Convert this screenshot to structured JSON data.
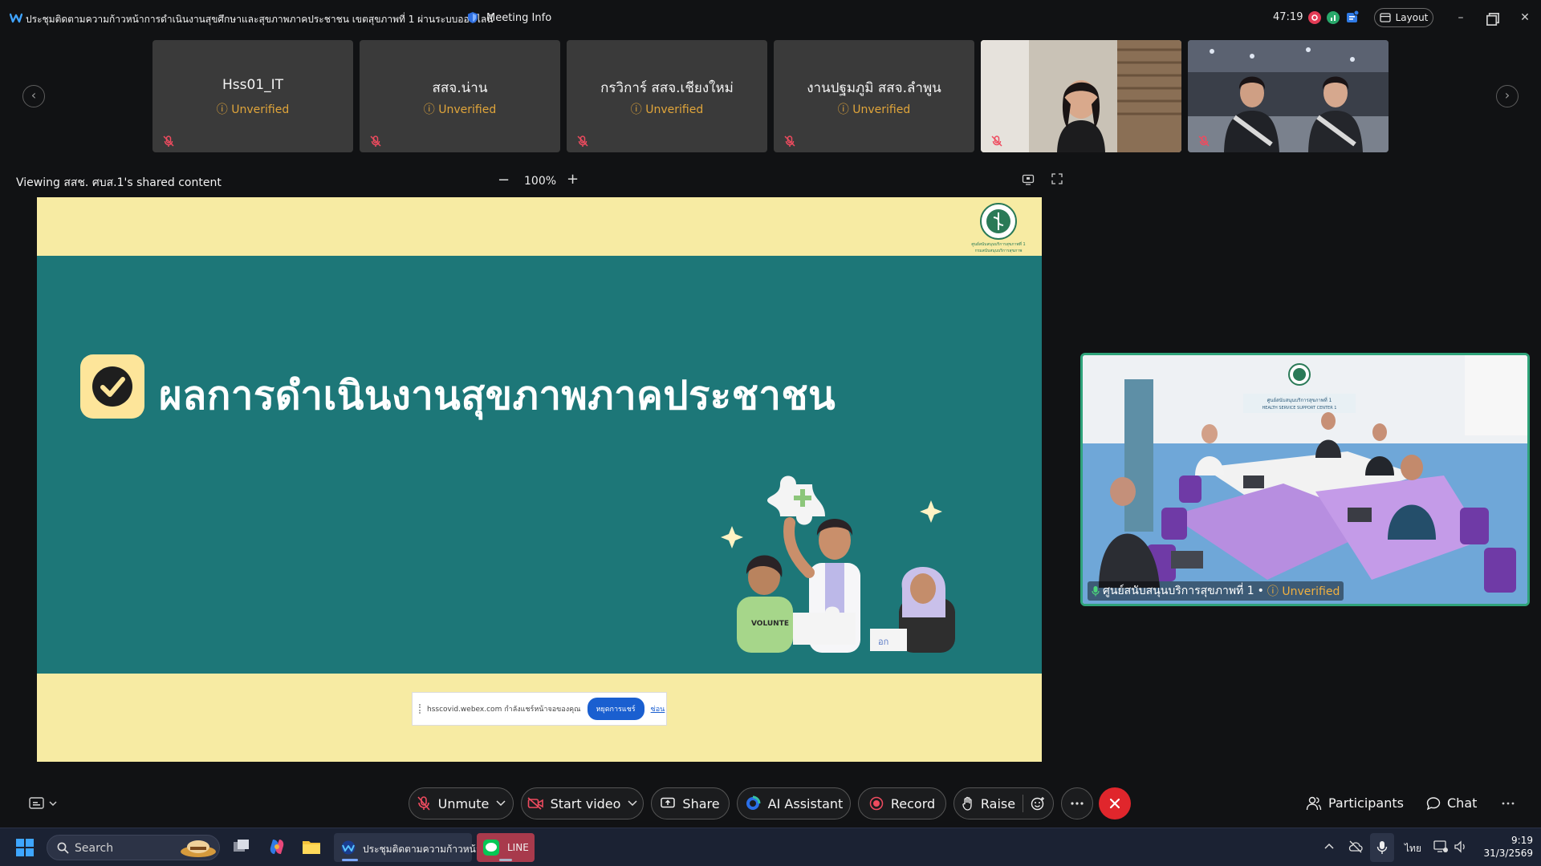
{
  "titlebar": {
    "meeting_title": "ประชุมติดตามความก้าวหน้าการดำเนินงานสุขศึกษาและสุขภาพภาคประชาชน เขตสุขภาพที่ 1 ผ่านระบบออนไลน์",
    "meeting_info": "Meeting Info",
    "timer": "47:19",
    "layout_label": "Layout"
  },
  "participants": [
    {
      "name": "Hss01_IT",
      "status": "Unverified",
      "video": false
    },
    {
      "name": "สสจ.น่าน",
      "status": "Unverified",
      "video": false
    },
    {
      "name": "กรวิการ์ สสจ.เชียงใหม่",
      "status": "Unverified",
      "video": false
    },
    {
      "name": "งานปฐมภูมิ สสจ.ลำพูน",
      "status": "Unverified",
      "video": false
    },
    {
      "name": "",
      "status": "",
      "video": true
    },
    {
      "name": "",
      "status": "",
      "video": true
    }
  ],
  "share": {
    "viewing_label": "Viewing สสช. ศบส.1's shared content",
    "zoom": "100%"
  },
  "slide": {
    "title": "ผลการดำเนินงานสุขภาพภาคประชาชน",
    "emblem_caption_1": "ศูนย์สนับสนุนบริการสุขภาพที่ 1",
    "emblem_caption_2": "กรมสนับสนุนบริการสุขภาพ",
    "illustration_shirt_text": "VOLUNTE",
    "illustration_sign_text": "อก",
    "notice_text": "hsscovid.webex.com กำลังแชร์หน้าจอของคุณ",
    "notice_button": "หยุดการแชร์",
    "notice_link": "ซ่อน"
  },
  "main_video": {
    "name": "ศูนย์สนับสนุนบริการสุขภาพที่ 1",
    "separator": "•",
    "status": "Unverified",
    "wall_sign_line1": "ศูนย์สนับสนุนบริการสุขภาพที่ 1",
    "wall_sign_line2": "HEALTH SERVICE SUPPORT CENTER 1"
  },
  "toolbar": {
    "unmute": "Unmute",
    "start_video": "Start video",
    "share": "Share",
    "ai_assistant": "AI Assistant",
    "record": "Record",
    "raise": "Raise",
    "participants": "Participants",
    "chat": "Chat"
  },
  "taskbar": {
    "search_placeholder": "Search",
    "webex_window": "ประชุมติดตามความก้าวหน้า",
    "line_window": "LINE",
    "language": "ไทย",
    "time": "9:19",
    "date": "31/3/2569"
  },
  "colors": {
    "accent_green": "#2fa37a",
    "unverified": "#e0a53a",
    "end_call": "#e0262c",
    "slide_teal": "#1d7778",
    "slide_cream": "#f7eba3"
  }
}
